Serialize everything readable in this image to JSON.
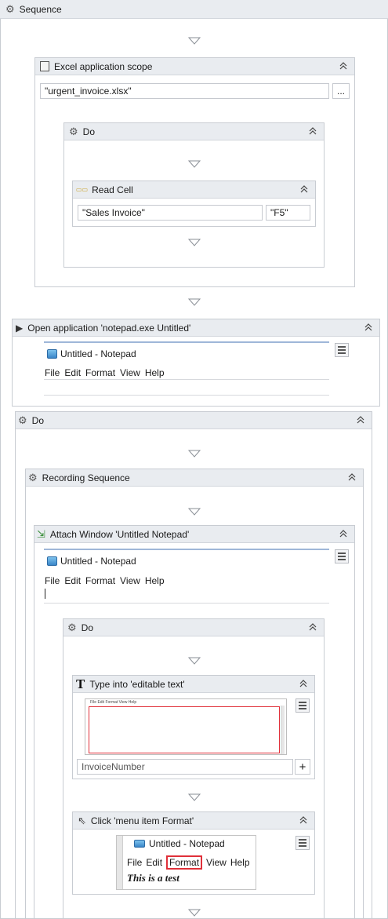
{
  "sequence": {
    "title": "Sequence"
  },
  "excel_scope": {
    "title": "Excel application scope",
    "path_value": "\"urgent_invoice.xlsx\"",
    "browse_label": "..."
  },
  "do1": {
    "title": "Do"
  },
  "read_cell": {
    "title": "Read Cell",
    "sheet_value": "\"Sales Invoice\"",
    "cell_value": "\"F5\""
  },
  "open_app": {
    "title": "Open application 'notepad.exe Untitled'",
    "window_title": "Untitled - Notepad",
    "menu": [
      "File",
      "Edit",
      "Format",
      "View",
      "Help"
    ]
  },
  "do2": {
    "title": "Do"
  },
  "recording": {
    "title": "Recording Sequence"
  },
  "attach": {
    "title": "Attach Window 'Untitled  Notepad'",
    "window_title": "Untitled - Notepad",
    "menu": [
      "File",
      "Edit",
      "Format",
      "View",
      "Help"
    ]
  },
  "do3": {
    "title": "Do"
  },
  "type_into": {
    "title": "Type into 'editable text'",
    "thumb_menu": "File  Edit  Format  View  Help",
    "text_value": "InvoiceNumber",
    "plus_label": "+"
  },
  "click": {
    "title": "Click 'menu item  Format'",
    "window_title": "Untitled - Notepad",
    "menu": [
      "File",
      "Edit",
      "Format",
      "View",
      "Help"
    ],
    "body_text": "This is a test"
  },
  "colors": {
    "header_bg": "#e9ecf0",
    "highlight": "#e0303a",
    "accent": "#9fb7d8"
  }
}
